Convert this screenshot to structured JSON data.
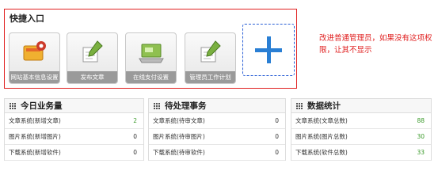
{
  "quick": {
    "title": "快捷入口",
    "tiles": [
      {
        "label": "网站基本信息设置",
        "icon": "gear-settings-icon"
      },
      {
        "label": "发布文章",
        "icon": "pencil-paper-icon"
      },
      {
        "label": "在线支付设置",
        "icon": "laptop-payment-icon"
      },
      {
        "label": "管理员工作计划",
        "icon": "pencil-paper-icon"
      }
    ],
    "add_icon": "plus-icon"
  },
  "note": "改进普通管理员，如果没有这项权限，让其不显示",
  "cards": [
    {
      "title": "今日业务量",
      "rows": [
        {
          "label": "文章系统(新增文章)",
          "value": "2"
        },
        {
          "label": "图片系统(新增图片)",
          "value": "0"
        },
        {
          "label": "下载系统(新增软件)",
          "value": "0"
        }
      ]
    },
    {
      "title": "待处理事务",
      "rows": [
        {
          "label": "文章系统(待审文章)",
          "value": "0"
        },
        {
          "label": "图片系统(待审图片)",
          "value": "0"
        },
        {
          "label": "下载系统(待审软件)",
          "value": "0"
        }
      ]
    },
    {
      "title": "数据统计",
      "rows": [
        {
          "label": "文章系统(文章总数)",
          "value": "88"
        },
        {
          "label": "图片系统(图片总数)",
          "value": "30"
        },
        {
          "label": "下载系统(软件总数)",
          "value": "33"
        }
      ]
    }
  ],
  "colors": {
    "accent_red": "#e02020",
    "plus_blue": "#2a7fd4",
    "value_green": "#3a9a2a"
  }
}
